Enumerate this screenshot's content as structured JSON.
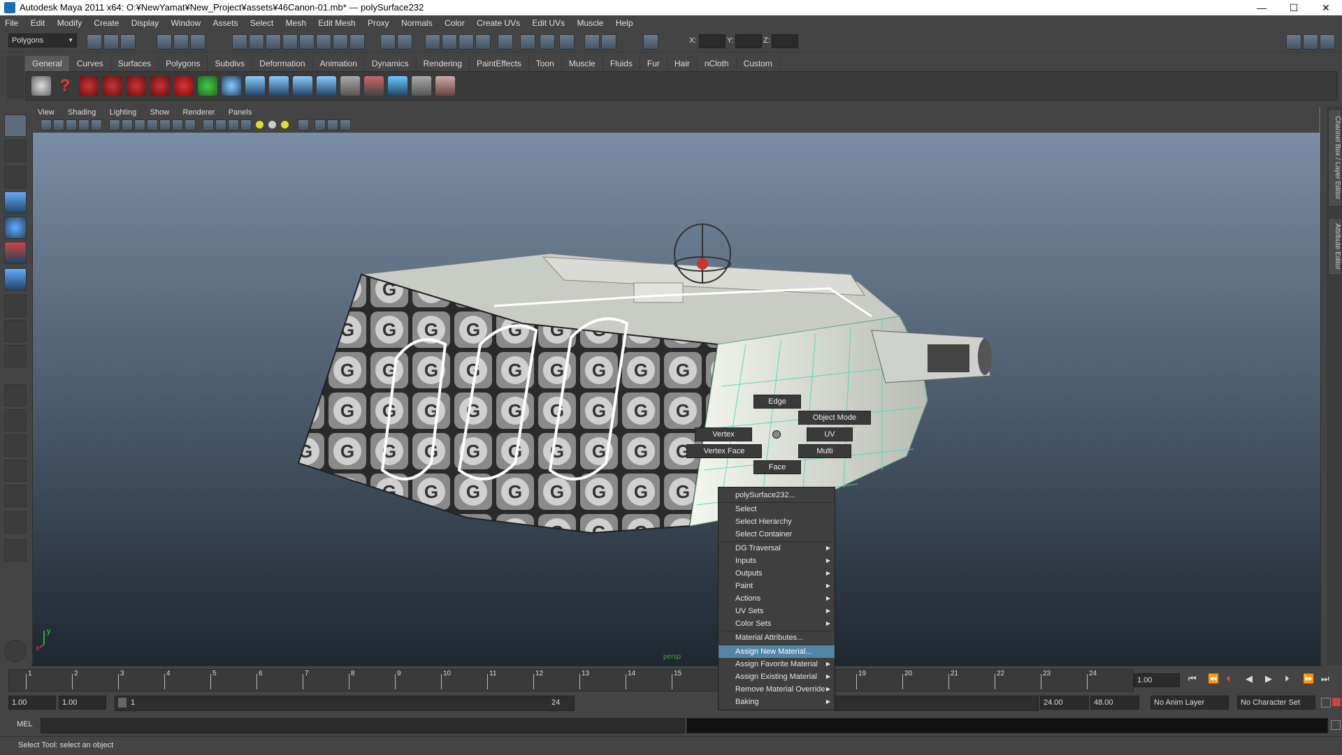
{
  "window": {
    "title": "Autodesk Maya 2011 x64: O:¥NewYamat¥New_Project¥assets¥46Canon-01.mb*  ---  polySurface232",
    "minimize": "—",
    "maximize": "☐",
    "close": "✕"
  },
  "menubar": [
    "File",
    "Edit",
    "Modify",
    "Create",
    "Display",
    "Window",
    "Assets",
    "Select",
    "Mesh",
    "Edit Mesh",
    "Proxy",
    "Normals",
    "Color",
    "Create UVs",
    "Edit UVs",
    "Muscle",
    "Help"
  ],
  "statusline": {
    "mode": "Polygons",
    "x_label": "X:",
    "y_label": "Y:",
    "z_label": "Z:"
  },
  "shelf": {
    "tabs": [
      "General",
      "Curves",
      "Surfaces",
      "Polygons",
      "Subdivs",
      "Deformation",
      "Animation",
      "Dynamics",
      "Rendering",
      "PaintEffects",
      "Toon",
      "Muscle",
      "Fluids",
      "Fur",
      "Hair",
      "nCloth",
      "Custom"
    ],
    "active_tab": "General"
  },
  "viewport": {
    "menu": [
      "View",
      "Shading",
      "Lighting",
      "Show",
      "Renderer",
      "Panels"
    ],
    "camera_label": "persp",
    "axis_y": "y",
    "axis_x": "x"
  },
  "right_tabs": [
    "Channel Box / Layer Editor",
    "Attribute Editor"
  ],
  "marking_menu": {
    "edge": "Edge",
    "object_mode": "Object Mode",
    "vertex": "Vertex",
    "uv": "UV",
    "vertex_face": "Vertex Face",
    "multi": "Multi",
    "face": "Face"
  },
  "context_menu": {
    "header": "polySurface232...",
    "items": [
      {
        "label": "Select",
        "sub": false
      },
      {
        "label": "Select Hierarchy",
        "sub": false
      },
      {
        "label": "Select Container",
        "sub": false
      },
      {
        "label": "DG Traversal",
        "sub": true
      },
      {
        "label": "Inputs",
        "sub": true
      },
      {
        "label": "Outputs",
        "sub": true
      },
      {
        "label": "Paint",
        "sub": true
      },
      {
        "label": "Actions",
        "sub": true
      },
      {
        "label": "UV Sets",
        "sub": true
      },
      {
        "label": "Color Sets",
        "sub": true
      },
      {
        "label": "Material Attributes...",
        "sub": false
      },
      {
        "label": "Assign New Material...",
        "sub": false
      },
      {
        "label": "Assign Favorite Material",
        "sub": true
      },
      {
        "label": "Assign Existing Material",
        "sub": true
      },
      {
        "label": "Remove Material Override",
        "sub": true
      },
      {
        "label": "Baking",
        "sub": true
      }
    ],
    "highlighted": "Assign New Material..."
  },
  "timeline": {
    "ticks": [
      "1",
      "2",
      "3",
      "4",
      "5",
      "6",
      "7",
      "8",
      "9",
      "10",
      "11",
      "12",
      "13",
      "14",
      "15",
      "19",
      "20",
      "21",
      "22",
      "23",
      "24"
    ],
    "current_frame": "1.00"
  },
  "range": {
    "start": "1.00",
    "playback_start": "1.00",
    "range_start_label": "1",
    "range_end_label": "24",
    "playback_end": "24.00",
    "end": "48.00",
    "anim_layer": "No Anim Layer",
    "character_set": "No Character Set"
  },
  "command": {
    "label": "MEL"
  },
  "help_line": "Select Tool: select an object",
  "colors": {
    "highlight": "#5285a6",
    "ui_bg": "#444444",
    "sky_top": "#7e92aa",
    "sky_bottom": "#1f2730"
  }
}
